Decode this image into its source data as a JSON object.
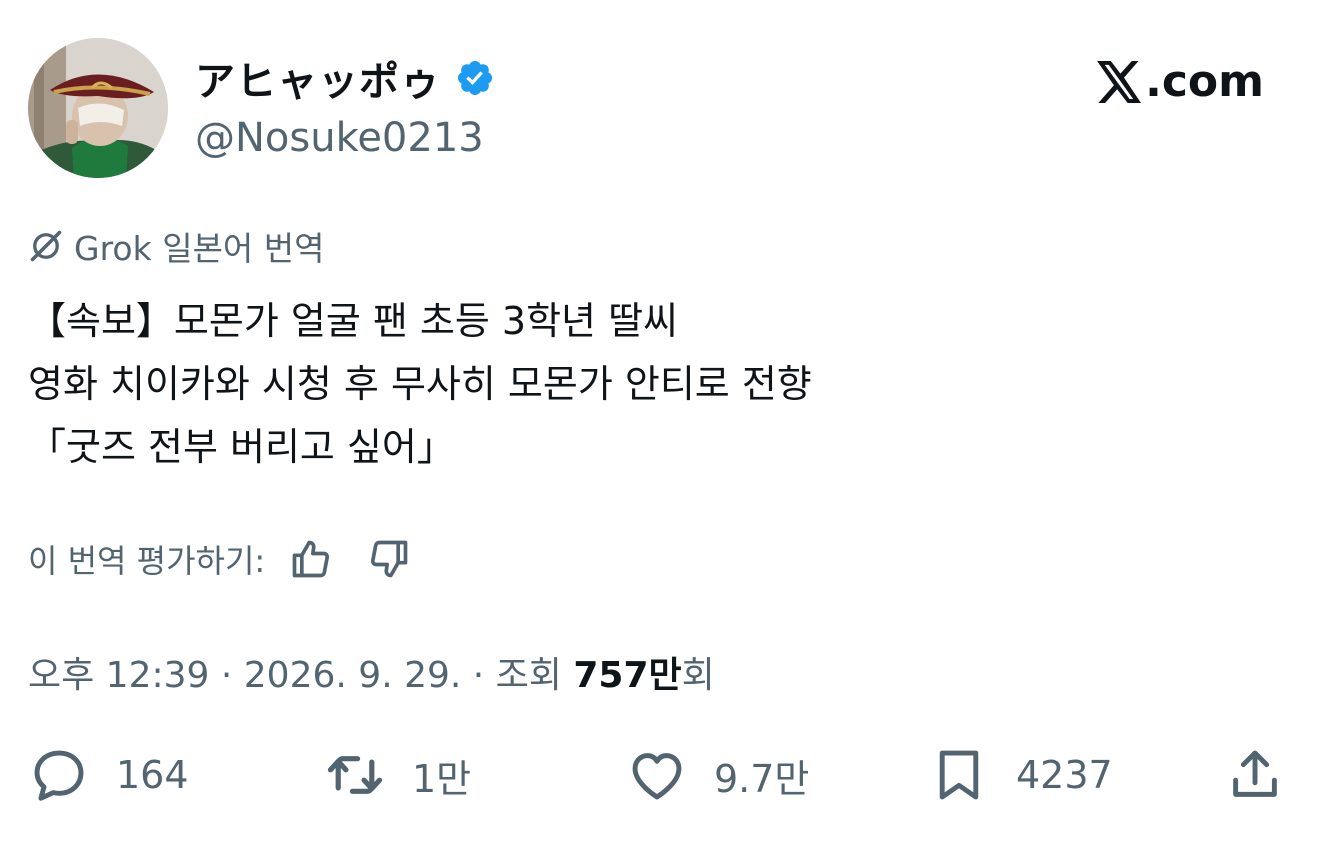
{
  "author": {
    "display_name": "アヒャッポゥ",
    "handle": "@Nosuke0213",
    "verified": true,
    "verified_color": "#1d9bf0"
  },
  "site_logo": ".com",
  "translation": {
    "label": "Grok 일본어 번역",
    "icon": "grok-icon"
  },
  "tweet": {
    "lines": [
      "【속보】모몬가 얼굴 팬 초등 3학년 딸씨",
      "영화 치이카와 시청 후 무사히 모몬가 안티로 전향",
      "「굿즈 전부 버리고 싶어」"
    ]
  },
  "rating": {
    "label": "이 번역 평가하기:",
    "like_icon": "thumbs-up-icon",
    "dislike_icon": "thumbs-down-icon"
  },
  "meta": {
    "time": "오후 12:39",
    "separator": " · ",
    "date": "2026. 9. 29.",
    "separator2": " · ",
    "views_prefix": "조회 ",
    "views_count": "757만",
    "views_suffix": "회"
  },
  "actions": {
    "replies": "164",
    "retweets": "1만",
    "likes": "9.7만",
    "bookmarks": "4237"
  },
  "colors": {
    "text": "#0f1419",
    "secondary": "#536471",
    "accent": "#1d9bf0"
  }
}
